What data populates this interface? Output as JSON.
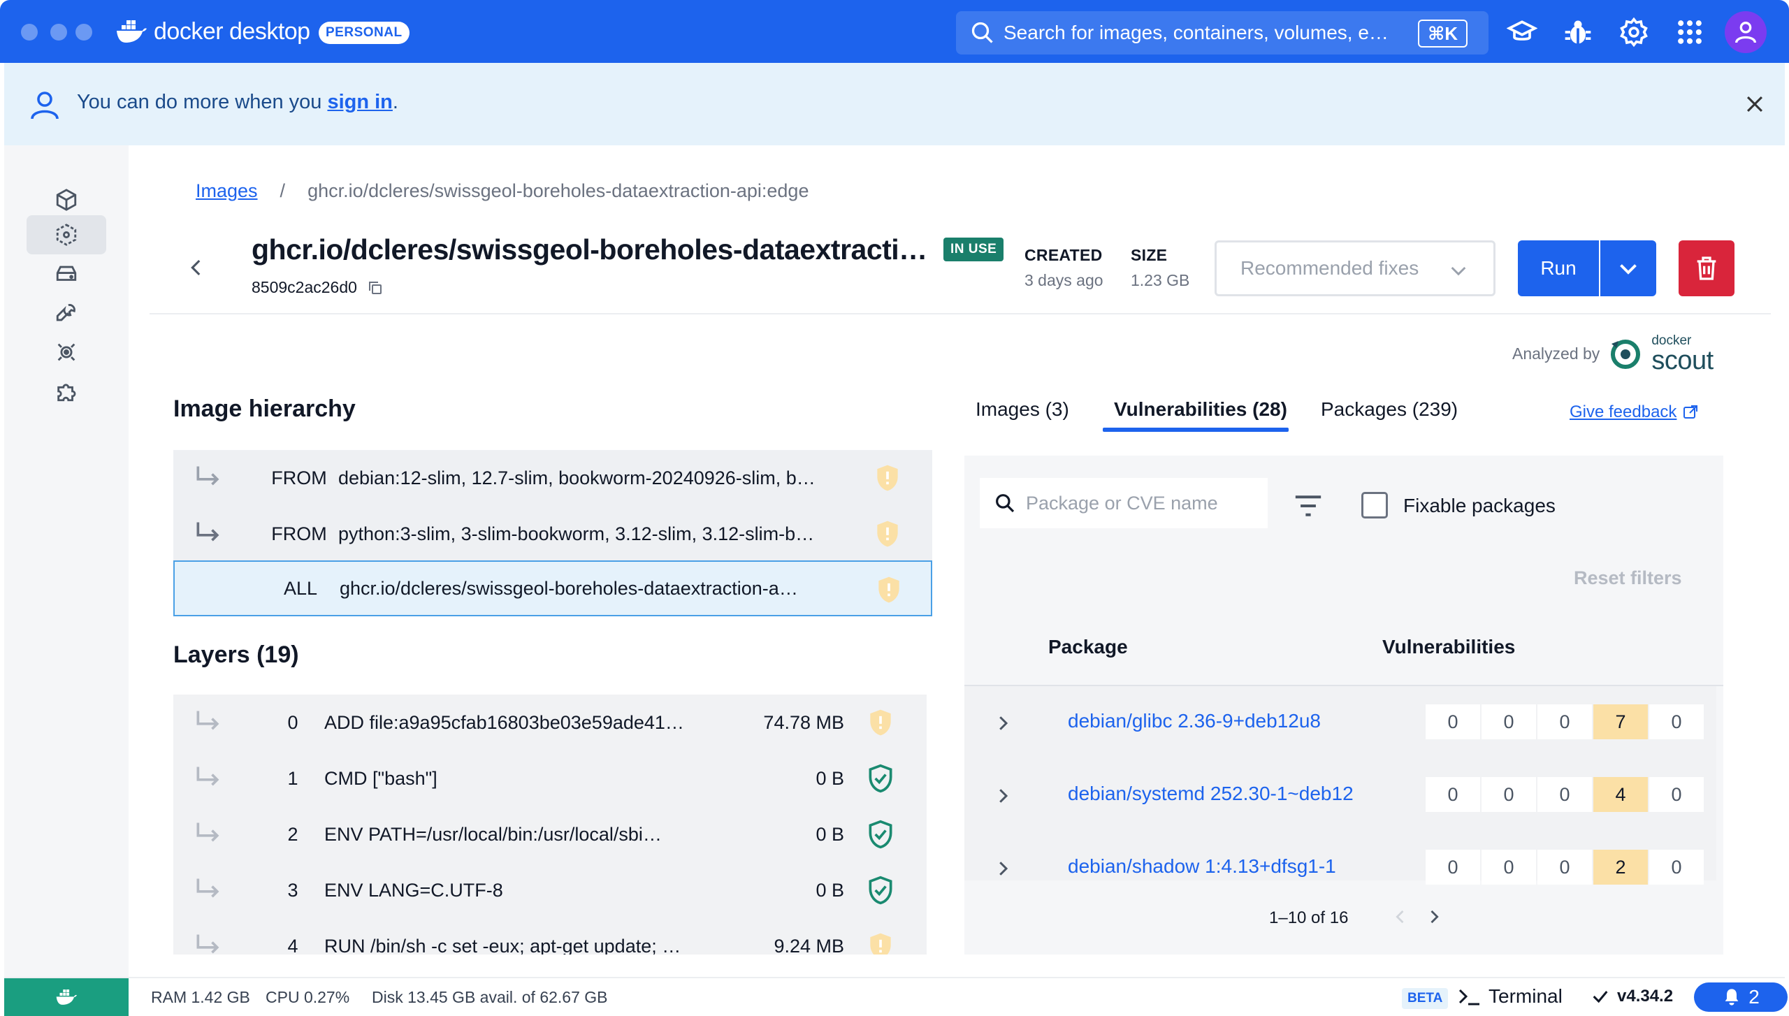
{
  "app": {
    "brand": "docker desktop",
    "plan_badge": "PERSONAL",
    "search_placeholder": "Search for images, containers, volumes, e…",
    "search_shortcut": "⌘K"
  },
  "banner": {
    "text_before": "You can do more when you ",
    "link": "sign in",
    "text_after": "."
  },
  "breadcrumb": {
    "root": "Images",
    "separator": "/",
    "current": "ghcr.io/dcleres/swissgeol-boreholes-dataextraction-api:edge"
  },
  "image": {
    "title": "ghcr.io/dcleres/swissgeol-boreholes-dataextracti…",
    "id": "8509c2ac26d0",
    "status_badge": "IN USE",
    "created_label": "CREATED",
    "created_value": "3 days ago",
    "size_label": "SIZE",
    "size_value": "1.23 GB",
    "recommended_fixes": "Recommended fixes",
    "run_label": "Run"
  },
  "analyzed": {
    "label": "Analyzed by",
    "brand_small": "docker",
    "brand_big": "scout"
  },
  "hierarchy": {
    "title": "Image hierarchy",
    "rows": [
      {
        "kind": "FROM",
        "name": "debian:12-slim, 12.7-slim, bookworm-20240926-slim, b…"
      },
      {
        "kind": "FROM",
        "name": "python:3-slim, 3-slim-bookworm, 3.12-slim, 3.12-slim-b…"
      },
      {
        "kind": "ALL",
        "name": "ghcr.io/dcleres/swissgeol-boreholes-dataextraction-a…"
      }
    ]
  },
  "layers": {
    "title": "Layers (19)",
    "rows": [
      {
        "index": "0",
        "cmd": "ADD file:a9a95cfab16803be03e59ade41…",
        "size": "74.78 MB",
        "status": "warning"
      },
      {
        "index": "1",
        "cmd": "CMD [\"bash\"]",
        "size": "0 B",
        "status": "ok"
      },
      {
        "index": "2",
        "cmd": "ENV PATH=/usr/local/bin:/usr/local/sbi…",
        "size": "0 B",
        "status": "ok"
      },
      {
        "index": "3",
        "cmd": "ENV LANG=C.UTF-8",
        "size": "0 B",
        "status": "ok"
      },
      {
        "index": "4",
        "cmd": "RUN /bin/sh -c set -eux; apt-get update; …",
        "size": "9.24 MB",
        "status": "warning"
      }
    ]
  },
  "tabs": [
    {
      "label": "Images (3)"
    },
    {
      "label": "Vulnerabilities (28)"
    },
    {
      "label": "Packages (239)"
    }
  ],
  "feedback": "Give feedback",
  "vuln": {
    "filter_placeholder": "Package or CVE name",
    "fixable_label": "Fixable packages",
    "reset_filters": "Reset filters",
    "col_package": "Package",
    "col_vulnerabilities": "Vulnerabilities",
    "rows": [
      {
        "name": "debian/glibc 2.36-9+deb12u8",
        "counts": [
          "0",
          "0",
          "0",
          "7",
          "0"
        ]
      },
      {
        "name": "debian/systemd 252.30-1~deb12",
        "counts": [
          "0",
          "0",
          "0",
          "4",
          "0"
        ]
      },
      {
        "name": "debian/shadow 1:4.13+dfsg1-1",
        "counts": [
          "0",
          "0",
          "0",
          "2",
          "0"
        ]
      }
    ],
    "pagination": "1–10 of 16"
  },
  "footer": {
    "ram": "RAM 1.42 GB",
    "cpu": "CPU 0.27%",
    "disk": "Disk 13.45 GB avail. of 62.67 GB",
    "beta": "BETA",
    "terminal": "Terminal",
    "version": "v4.34.2",
    "notifications": "2"
  },
  "colors": {
    "accent": "#1d63ed",
    "danger": "#d9253b",
    "in_use": "#1a7f6b",
    "warning_cell": "#fbe0a6",
    "footer_tile": "#1a9e80"
  }
}
